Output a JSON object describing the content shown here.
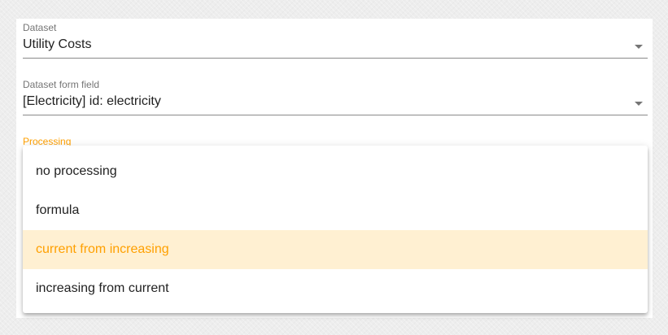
{
  "form": {
    "dataset": {
      "label": "Dataset",
      "value": "Utility Costs"
    },
    "form_field": {
      "label": "Dataset form field",
      "value": "[Electricity] id: electricity"
    },
    "processing": {
      "label": "Processing",
      "options": [
        {
          "label": "no processing",
          "selected": false
        },
        {
          "label": "formula",
          "selected": false
        },
        {
          "label": "current from increasing",
          "selected": true
        },
        {
          "label": "increasing from current",
          "selected": false
        }
      ]
    }
  },
  "colors": {
    "accent": "#ffa000",
    "selected_bg": "#fff0d2",
    "text": "#212121",
    "label": "#757575",
    "page_bg": "#ededed"
  },
  "icons": {
    "dropdown_arrow": "arrow-drop-down-icon"
  }
}
